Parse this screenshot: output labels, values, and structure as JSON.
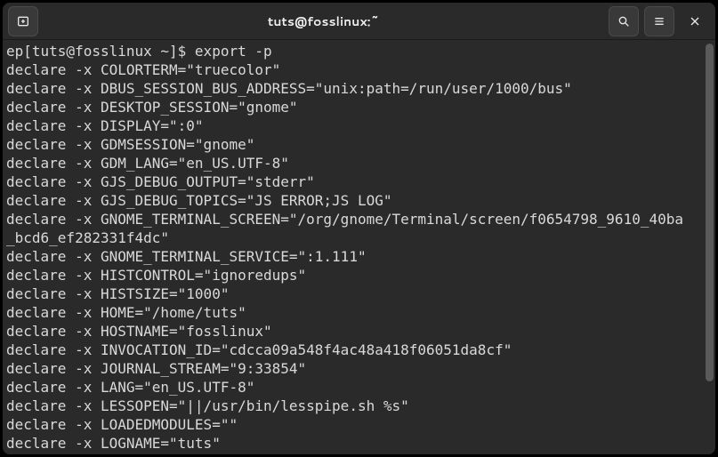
{
  "window": {
    "title": "tuts@fosslinux:~"
  },
  "icons": {
    "newtab": "newtab-icon",
    "search": "search-icon",
    "menu": "hamburger-icon",
    "close": "close-icon"
  },
  "terminal": {
    "prompt_prefix": "ep",
    "prompt": "[tuts@fosslinux ~]$ ",
    "command": "export -p",
    "lines": [
      "declare -x COLORTERM=\"truecolor\"",
      "declare -x DBUS_SESSION_BUS_ADDRESS=\"unix:path=/run/user/1000/bus\"",
      "declare -x DESKTOP_SESSION=\"gnome\"",
      "declare -x DISPLAY=\":0\"",
      "declare -x GDMSESSION=\"gnome\"",
      "declare -x GDM_LANG=\"en_US.UTF-8\"",
      "declare -x GJS_DEBUG_OUTPUT=\"stderr\"",
      "declare -x GJS_DEBUG_TOPICS=\"JS ERROR;JS LOG\"",
      "declare -x GNOME_TERMINAL_SCREEN=\"/org/gnome/Terminal/screen/f0654798_9610_40ba_bcd6_ef282331f4dc\"",
      "declare -x GNOME_TERMINAL_SERVICE=\":1.111\"",
      "declare -x HISTCONTROL=\"ignoredups\"",
      "declare -x HISTSIZE=\"1000\"",
      "declare -x HOME=\"/home/tuts\"",
      "declare -x HOSTNAME=\"fosslinux\"",
      "declare -x INVOCATION_ID=\"cdcca09a548f4ac48a418f06051da8cf\"",
      "declare -x JOURNAL_STREAM=\"9:33854\"",
      "declare -x LANG=\"en_US.UTF-8\"",
      "declare -x LESSOPEN=\"||/usr/bin/lesspipe.sh %s\"",
      "declare -x LOADEDMODULES=\"\"",
      "declare -x LOGNAME=\"tuts\""
    ]
  },
  "wrap_cols": 79
}
